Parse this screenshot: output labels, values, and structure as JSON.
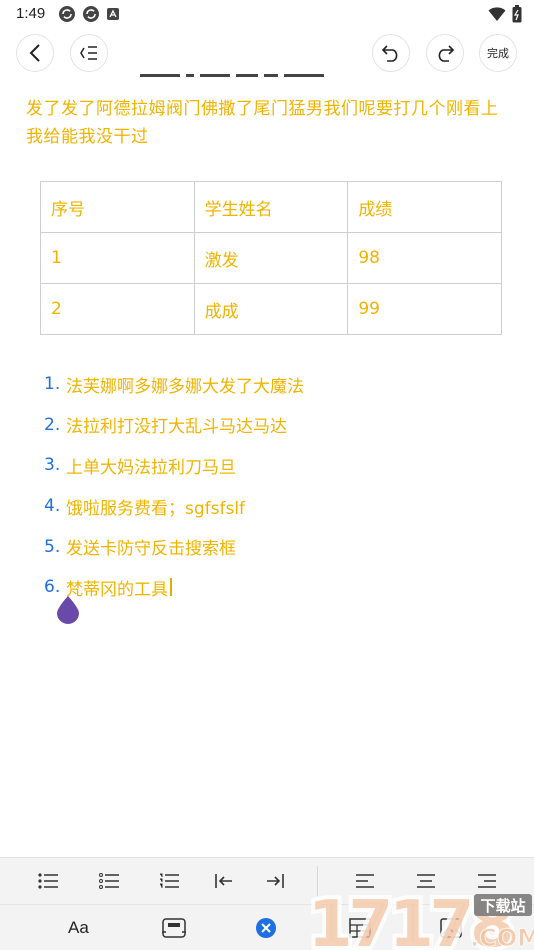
{
  "status_bar": {
    "time": "1:49"
  },
  "toolbar": {
    "done_label": "完成"
  },
  "editor": {
    "paragraph": "发了发了阿德拉姆阀门佛撒了尾门猛男我们呢要打几个刚看上我给能我没干过",
    "table": [
      [
        "序号",
        "学生姓名",
        "成绩"
      ],
      [
        "1",
        "激发",
        "98"
      ],
      [
        "2",
        "成成",
        "99"
      ]
    ],
    "list": [
      {
        "num": "1.",
        "text": "法芙娜啊多娜多娜大发了大魔法"
      },
      {
        "num": "2.",
        "text": "法拉利打没打大乱斗马达马达"
      },
      {
        "num": "3.",
        "text": "上单大妈法拉利刀马旦"
      },
      {
        "num": "4.",
        "text": "饿啦服务费看；sgfsfslf"
      },
      {
        "num": "5.",
        "text": "发送卡防守反击搜索框"
      },
      {
        "num": "6.",
        "text": "梵蒂冈的工具"
      }
    ]
  },
  "bottom_toolbar": {
    "text_style_label": "Aa"
  },
  "watermark": {
    "brand": "17178",
    "badge": "下载站",
    "suffix": ".COM"
  },
  "colors": {
    "text_yellow": "#f0b400",
    "list_number_blue": "#1e6fe0",
    "cursor_purple": "#6a4aa8",
    "active_blue": "#1e6fe0"
  }
}
